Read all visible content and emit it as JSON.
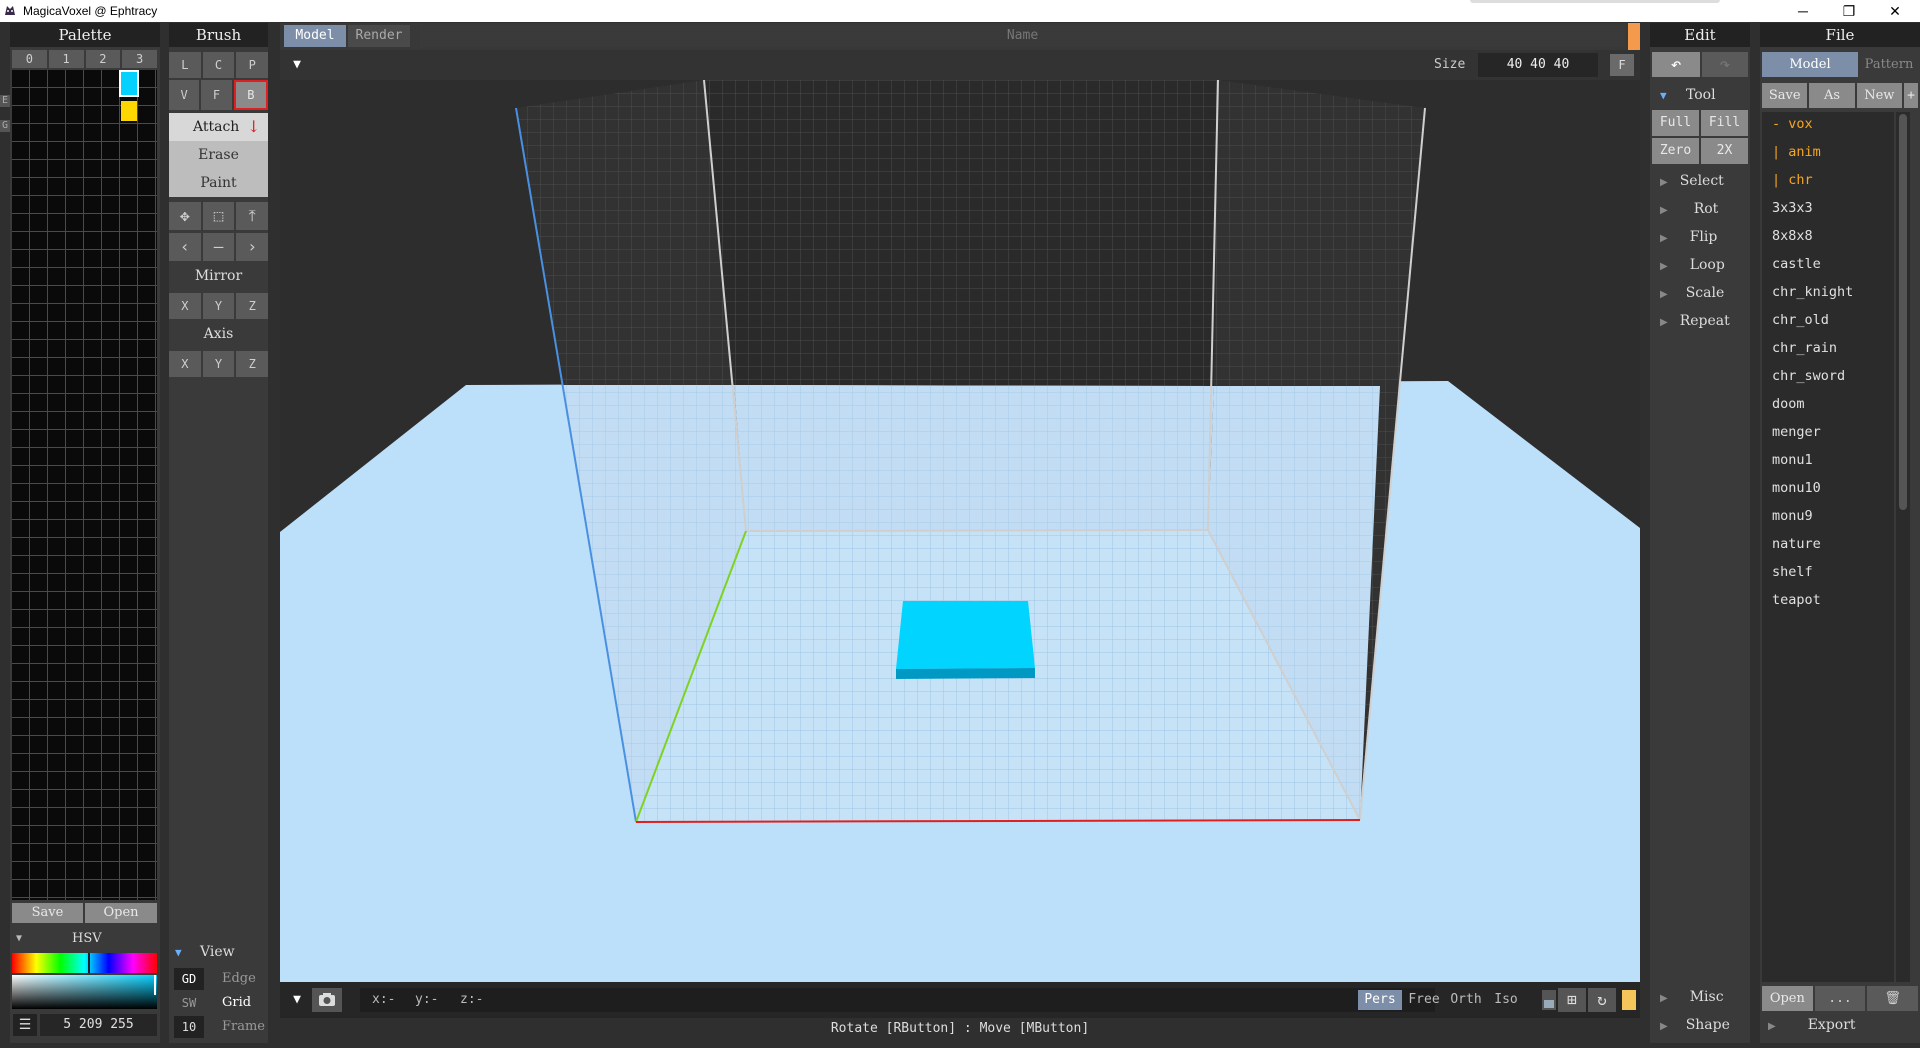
{
  "window": {
    "title": "MagicaVoxel @ Ephtracy",
    "minimize": "─",
    "restore": "❐",
    "close": "✕"
  },
  "palette": {
    "header": "Palette",
    "tabs": [
      "0",
      "1",
      "2",
      "3"
    ],
    "side_letters": [
      "E",
      "G"
    ],
    "save": "Save",
    "open": "Open",
    "hsv_label": "HSV",
    "menu_glyph": "☰",
    "value": "5 209 255",
    "selected_color": "#05d1ff",
    "secondary_color": "#ffd700"
  },
  "brush": {
    "header": "Brush",
    "row1": [
      "L",
      "C",
      "P"
    ],
    "row2": [
      "V",
      "F",
      "B"
    ],
    "modes": [
      "Attach",
      "Erase",
      "Paint"
    ],
    "mirror_label": "Mirror",
    "mirror": [
      "X",
      "Y",
      "Z"
    ],
    "axis_label": "Axis",
    "axis": [
      "X",
      "Y",
      "Z"
    ],
    "move_icons": [
      "✥",
      "⬚",
      "⤒"
    ],
    "nav_icons": [
      "‹",
      "–",
      "›"
    ]
  },
  "view": {
    "label": "View",
    "rows": [
      {
        "key": "GD",
        "name": "Edge"
      },
      {
        "key": "SW",
        "name": "Grid"
      },
      {
        "key": "10",
        "name": "Frame"
      }
    ]
  },
  "viewport": {
    "tabs": [
      "Model",
      "Render"
    ],
    "name_placeholder": "Name",
    "size_label": "Size",
    "size_value": "40 40 40",
    "f_button": "F",
    "coords": [
      "x:-",
      "y:-",
      "z:-"
    ],
    "camera_modes": [
      "Pers",
      "Free",
      "Orth",
      "Iso"
    ],
    "active_camera": "Pers",
    "status": "Rotate [RButton] : Move [MButton]",
    "voxel_color": "#00d4ff"
  },
  "edit": {
    "header": "Edit",
    "undo": "↶",
    "redo": "↷",
    "tool_label": "Tool",
    "tool_buttons": [
      "Full",
      "Fill",
      "Zero",
      "2X"
    ],
    "sections": [
      "Select",
      "Rot",
      "Flip",
      "Loop",
      "Scale",
      "Repeat"
    ],
    "bottom_sections": [
      "Misc",
      "Shape"
    ]
  },
  "file": {
    "header": "File",
    "tabs": [
      "Model",
      "Pattern"
    ],
    "actions": [
      "Save",
      "As",
      "New",
      "+"
    ],
    "folders": [
      "- vox",
      "| anim",
      "| chr"
    ],
    "files": [
      "3x3x3",
      "8x8x8",
      "castle",
      "chr_knight",
      "chr_old",
      "chr_rain",
      "chr_sword",
      "doom",
      "menger",
      "monu1",
      "monu10",
      "monu9",
      "nature",
      "shelf",
      "teapot"
    ],
    "open": "Open",
    "more": "...",
    "trash": "🗑",
    "export": "Export"
  }
}
